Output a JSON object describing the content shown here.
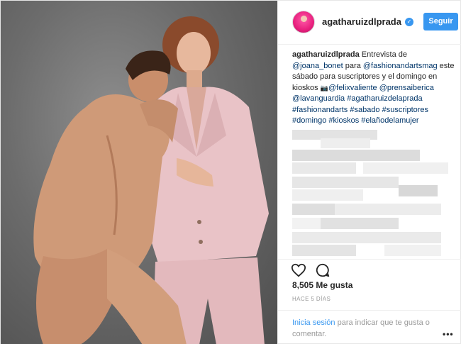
{
  "post": {
    "username": "agatharuizdlprada",
    "follow_label": "Seguir",
    "caption": {
      "author": "agatharuizdlprada",
      "text_1": " Entrevista de ",
      "mention_1": "@joana_bonet",
      "text_2": " para ",
      "mention_2": "@fashionandartsmag",
      "text_3": " este sábado para suscriptores y el domingo en kioskos ",
      "camera_glyph": "📷",
      "mention_3": "@felixvaliente",
      "mention_4": "@prensaiberica",
      "mention_5": "@lavanguardia",
      "hashtag_1": "#agatharuizdelaprada",
      "hashtag_2": "#fashionandarts",
      "hashtag_3": "#sabado",
      "hashtag_4": "#suscriptores",
      "hashtag_5": "#domingo",
      "hashtag_6": "#kioskos",
      "hashtag_7": "#elañodelamujer"
    },
    "likes": "8,505 Me gusta",
    "timestamp": "HACE 5 DÍAS",
    "login_link": "Inicia sesión",
    "login_rest": " para indicar que te gusta o comentar.",
    "more_label": "•••",
    "icons": [
      "verified-icon",
      "heart-icon",
      "comment-icon",
      "more-icon"
    ],
    "colors": {
      "accent": "#3897f0",
      "link": "#003569",
      "muted": "#999999",
      "avatar": "#e8207e",
      "suit": "#e8c2c6"
    }
  }
}
